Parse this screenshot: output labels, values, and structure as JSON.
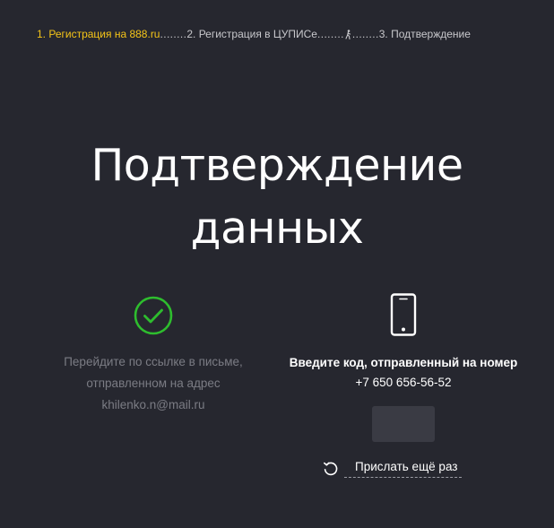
{
  "steps": {
    "step1": "1. Регистрация на 888.ru",
    "dots1": " ........ ",
    "step2": "2. Регистрация в ЦУПИСе",
    "dots2": " ........ ",
    "dots3": "........ ",
    "step3": "3. Подтверждение",
    "active_color": "#f5c518"
  },
  "title": "Подтверждение данных",
  "email": {
    "icon": "check-circle-icon",
    "line1": "Перейдите по ссылке в письме,",
    "line2": "отправленном на адрес",
    "address": "khilenko.n@mail.ru"
  },
  "phone": {
    "icon": "smartphone-icon",
    "line1": "Введите код, отправленный на номер",
    "number": "+7 650 656-56-52",
    "code_value": "",
    "resend_icon": "refresh-icon",
    "resend_label": "Прислать ещё раз"
  },
  "colors": {
    "background": "#26272f",
    "success": "#2ebd2e",
    "muted_text": "#7b7c84",
    "input_bg": "#3a3b44"
  }
}
